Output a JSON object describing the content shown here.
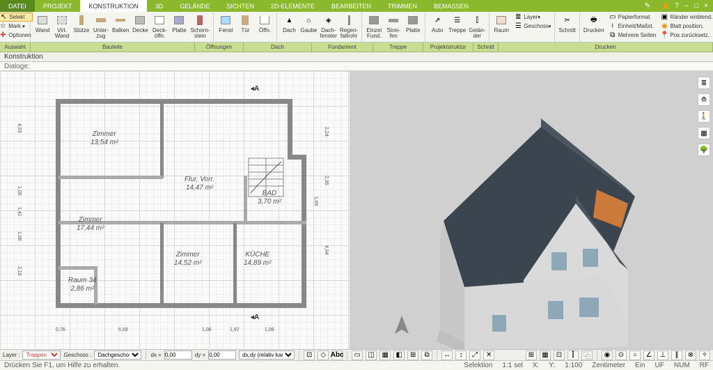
{
  "tabs": [
    "DATEI",
    "PROJEKT",
    "KONSTRUKTION",
    "3D",
    "GELÄNDE",
    "SICHTEN",
    "2D-ELEMENTE",
    "BEARBEITEN",
    "TRIMMEN",
    "BEMASSEN"
  ],
  "active_tab": "KONSTRUKTION",
  "ribbon_left": {
    "selekt": "Selekt",
    "mark": "Mark.",
    "optionen": "Optionen"
  },
  "ribbon": {
    "wand": "Wand",
    "virt_wand": "Virt.\nWand",
    "stutze": "Stütze",
    "unterzug": "Unter-\nzug",
    "balken": "Balken",
    "decke": "Decke",
    "deckoffn": "Deck-\nöffn.",
    "platte": "Platte",
    "schornstein": "Schorn-\nstein",
    "fenst": "Fenst",
    "tur": "Tür",
    "offn": "Öffn.",
    "dach": "Dach",
    "gaube": "Gaube",
    "dachfenster": "Dach-\nfenster",
    "regenfallrohr": "Regen-\nfallrohr",
    "einzelfund": "Einzel\nFund.",
    "streifen": "Strei-\nfen",
    "platte2": "Platte",
    "auto": "Auto",
    "treppe": "Treppe",
    "gelander": "Gelän-\nder",
    "raum": "Raum",
    "layer": "Layer",
    "geschoss": "Geschoss",
    "schnitt": "Schnitt",
    "drucken": "Drucken",
    "papierformat": "Papierformat",
    "einheit": "Einheit/Maßst.",
    "mehrere": "Mehrere Seiten",
    "rander": "Ränder einblend.",
    "blatt": "Blatt position.",
    "pos": "Pos zurücksetz."
  },
  "groups": {
    "auswahl": "Auswahl",
    "bauteile": "Bauteile",
    "offnungen": "Öffnungen",
    "dach": "Dach",
    "fundament": "Fundament",
    "treppe": "Treppe",
    "projektstruktur": "Projektstruktur",
    "schnitt": "Schnitt",
    "drucken": "Drucken"
  },
  "subtab": "Konstruktion",
  "dialoge": "Dialoge:",
  "rooms": {
    "zimmer1": {
      "name": "Zimmer",
      "area": "13,54 m²"
    },
    "zimmer2": {
      "name": "Zimmer",
      "area": "17,44 m²"
    },
    "zimmer3": {
      "name": "Zimmer",
      "area": "14,52 m²"
    },
    "flur": {
      "name": "Flur, Vorr.",
      "area": "14,47 m²"
    },
    "bad": {
      "name": "BAD",
      "area": "3,70 m²"
    },
    "kuche": {
      "name": "KÜCHE",
      "area": "14,89 m²"
    },
    "raum34": {
      "name": "Raum 34",
      "area": "2,86 m²"
    }
  },
  "dims": {
    "d1": "4,53",
    "d2": "1,05",
    "d3": "1,41",
    "d4": "1,06",
    "d5": "2,15",
    "d6": "0,76",
    "d7": "6,59",
    "d8": "1,08",
    "d9": "1,97",
    "d10": "1,08",
    "d11": "2,24",
    "d12": "2,35",
    "d13": "4,54",
    "d14": "1,69"
  },
  "section": "A",
  "bottom": {
    "layer_lbl": "Layer :",
    "layer_val": "Treppen",
    "geschoss_lbl": "Geschoss :",
    "geschoss_val": "Dachgeschoss",
    "dx_lbl": "dx =",
    "dx_val": "0,00",
    "dy_lbl": "dy =",
    "dy_val": "0,00",
    "dxdy_lbl": "dx,dy (relativ kartesisch)"
  },
  "status": {
    "help": "Drücken Sie F1, um Hilfe zu erhalten.",
    "selektion": "Selektion",
    "sel": "1:1 sel",
    "x": "X:",
    "y": "Y:",
    "scale": "1:100",
    "unit": "Zentimeter",
    "ein": "Ein",
    "uf": "UF",
    "num": "NUM",
    "rf": "RF"
  }
}
